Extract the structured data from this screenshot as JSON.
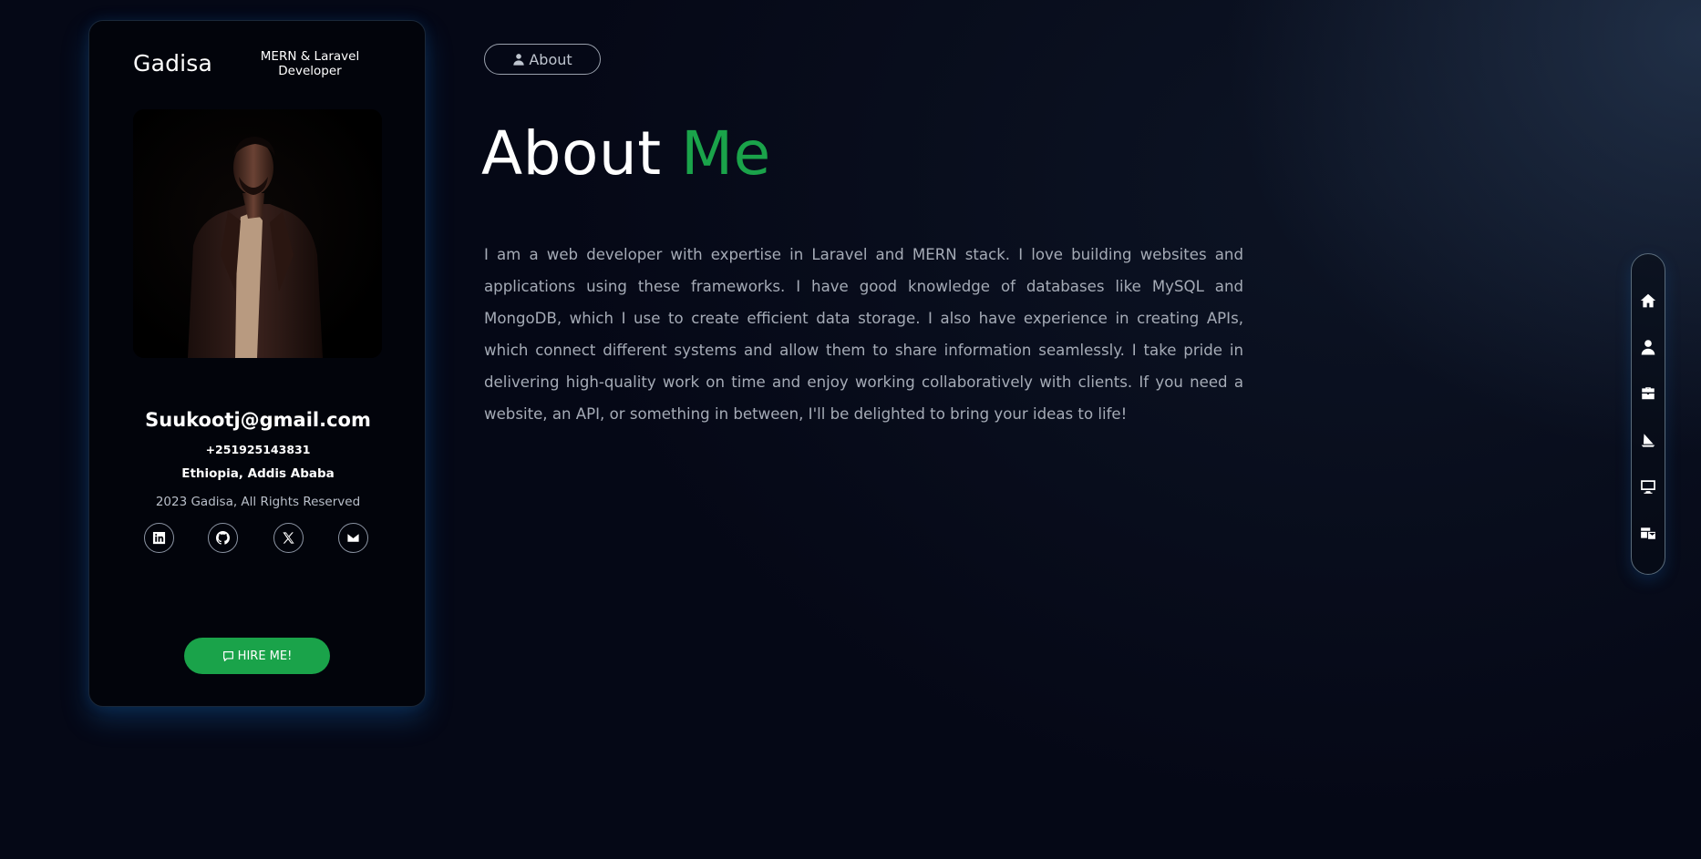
{
  "profile": {
    "name": "Gadisa",
    "role": "MERN & Laravel Developer",
    "photo_alt": "",
    "email": "Suukootj@gmail.com",
    "phone": "+251925143831",
    "location": "Ethiopia, Addis Ababa",
    "copyright": "2023 Gadisa, All Rights Reserved",
    "socials": [
      {
        "icon": "linkedin-icon"
      },
      {
        "icon": "github-icon"
      },
      {
        "icon": "x-icon"
      },
      {
        "icon": "envelope-icon"
      }
    ],
    "hire_label": "HIRE ME!"
  },
  "main": {
    "section_pill": "About",
    "heading_primary": "About",
    "heading_accent": "Me",
    "bio": "I am a web developer with expertise in Laravel and MERN stack. I love building websites and applications using these frameworks. I have good knowledge of databases like MySQL and MongoDB, which I use to create efficient data storage. I also have experience in creating APIs, which connect different systems and allow them to share information seamlessly. I take pride in delivering high-quality work on time and enjoy working collaboratively with clients. If you need a website, an API, or something in between, I'll be delighted to bring your ideas to life!"
  },
  "sidenav": {
    "items": [
      {
        "icon": "home-icon"
      },
      {
        "icon": "user-icon"
      },
      {
        "icon": "briefcase-icon"
      },
      {
        "icon": "sail-icon"
      },
      {
        "icon": "desktop-icon"
      },
      {
        "icon": "contact-icon"
      }
    ]
  },
  "colors": {
    "accent": "#1aa34a",
    "background": "#050816",
    "card": "#02040b",
    "muted_text": "#a5abb6"
  }
}
